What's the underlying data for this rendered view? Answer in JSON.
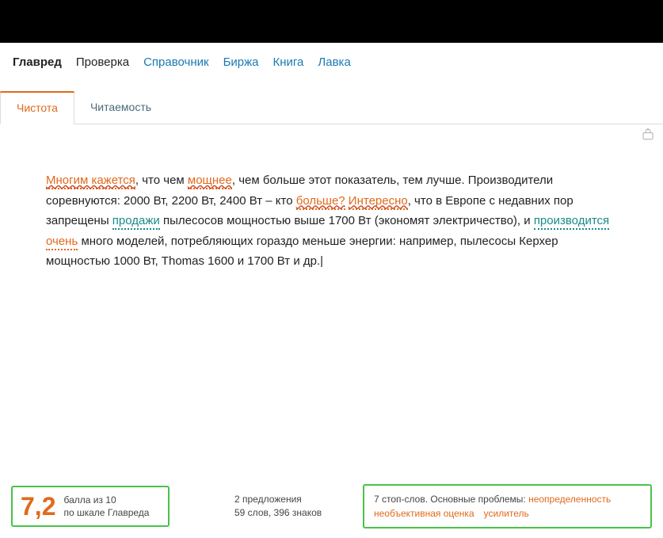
{
  "nav": {
    "brand": "Главред",
    "items": [
      "Проверка",
      "Справочник",
      "Биржа",
      "Книга",
      "Лавка"
    ],
    "link_flags": [
      false,
      true,
      true,
      true,
      true
    ]
  },
  "tabs": {
    "active": "Чистота",
    "other": "Читаемость"
  },
  "text": {
    "p1a": "Многим кажется",
    "p1b": ", что чем ",
    "p1c": "мощнее",
    "p1d": ", чем больше этот показатель, тем лучше. Производители соревнуются: 2000 Вт, 2200 Вт, 2400 Вт – кто ",
    "p1e": "больше?",
    "p1f": " ",
    "p1g": "Интересно",
    "p1h": ", что в Европе с недавних пор запрещены ",
    "p1i": "продажи",
    "p1j": " пылесосов мощностью выше 1700 Вт (экономят электричество), и ",
    "p1k": "производится",
    "p1l": " ",
    "p1m": "очень",
    "p1n": " много моделей, потребляющих гораздо меньше энергии: например, пылесосы Керхер мощностью 1000 Вт, Thomas 1600 и 1700 Вт и др.|"
  },
  "footer": {
    "score": "7,2",
    "score_label1": "балла из 10",
    "score_label2": "по шкале Главреда",
    "stats1": "2 предложения",
    "stats2": "59 слов, 396 знаков",
    "problems_lead": "7 стоп-слов. Основные проблемы: ",
    "problem1": "неопределенность",
    "problem2": "необъективная оценка",
    "problem3": "усилитель"
  }
}
